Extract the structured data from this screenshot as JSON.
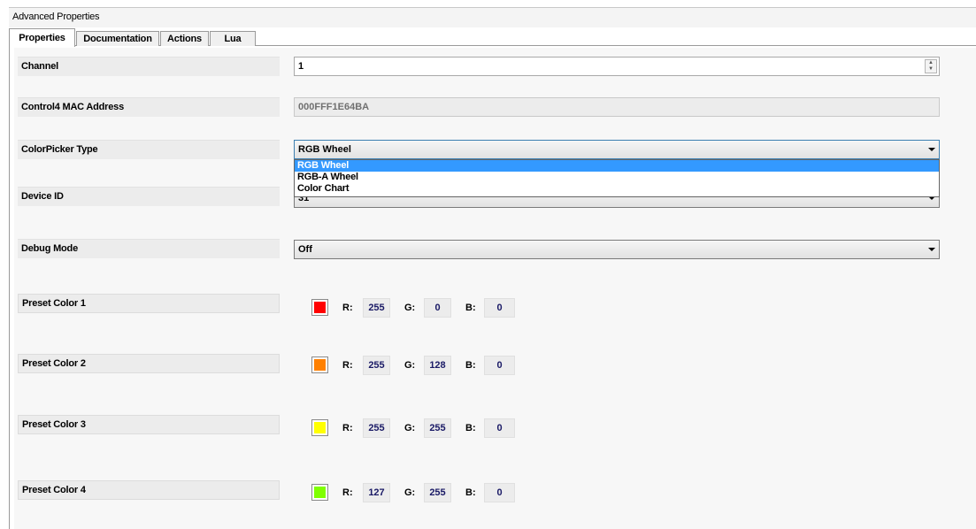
{
  "window": {
    "title": "Advanced Properties"
  },
  "tabs": [
    {
      "label": "Properties",
      "active": true
    },
    {
      "label": "Documentation",
      "active": false
    },
    {
      "label": "Actions",
      "active": false
    },
    {
      "label": "Lua",
      "active": false
    }
  ],
  "properties": {
    "channel": {
      "label": "Channel",
      "value": "1"
    },
    "mac": {
      "label": "Control4 MAC Address",
      "value": "000FFF1E64BA"
    },
    "colorpicker": {
      "label": "ColorPicker Type",
      "value": "RGB Wheel",
      "options": [
        "RGB Wheel",
        "RGB-A Wheel",
        "Color Chart"
      ]
    },
    "device_id": {
      "label": "Device ID",
      "value": "31"
    },
    "debug": {
      "label": "Debug Mode",
      "value": "Off"
    }
  },
  "component_labels": {
    "r": "R:",
    "g": "G:",
    "b": "B:"
  },
  "presets": [
    {
      "label": "Preset Color 1",
      "r": "255",
      "g": "0",
      "b": "0",
      "color": "#ff0000"
    },
    {
      "label": "Preset Color 2",
      "r": "255",
      "g": "128",
      "b": "0",
      "color": "#ff8000"
    },
    {
      "label": "Preset Color 3",
      "r": "255",
      "g": "255",
      "b": "0",
      "color": "#ffff00"
    },
    {
      "label": "Preset Color 4",
      "r": "127",
      "g": "255",
      "b": "0",
      "color": "#7fff00"
    }
  ]
}
